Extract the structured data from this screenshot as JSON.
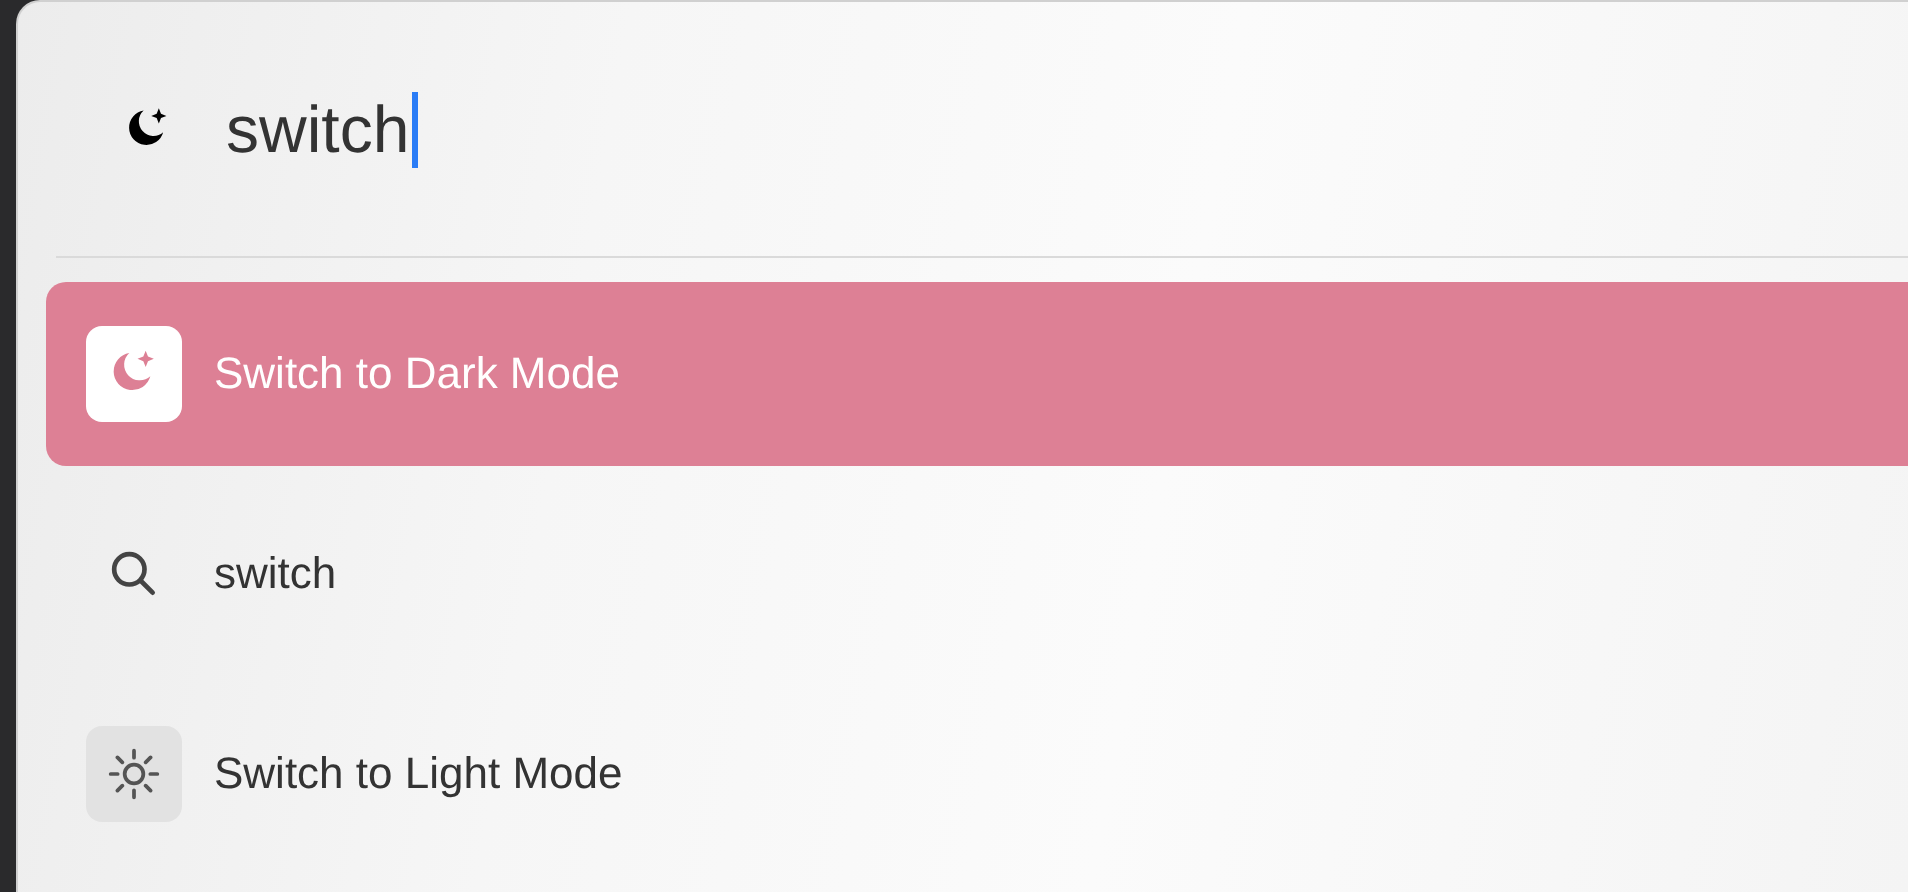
{
  "search": {
    "value": "switch"
  },
  "results": [
    {
      "kind": "dark",
      "label": "Switch to Dark Mode",
      "selected": true
    },
    {
      "kind": "search",
      "label": "switch",
      "selected": false
    },
    {
      "kind": "light",
      "label": "Switch to Light Mode",
      "selected": false
    }
  ]
}
